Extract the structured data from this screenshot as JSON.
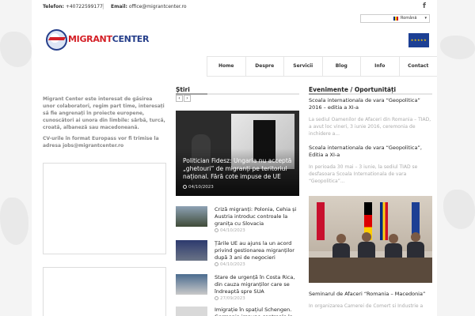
{
  "topbar": {
    "phone_label": "Telefon:",
    "phone": "+40722599177",
    "separator": "|",
    "email_label": "Email:",
    "email": "office@migrantcenter.ro",
    "social_icon": "f"
  },
  "language": {
    "selected": "Română",
    "caret": "▾"
  },
  "logo": {
    "word1": "MIGRANT",
    "word2": "CENTER"
  },
  "eu_flag_stars": "★★★★★",
  "nav": [
    "Home",
    "Despre",
    "Servicii",
    "Blog",
    "Info",
    "Contact"
  ],
  "intro": {
    "p1": "Migrant Center este interesat de găsirea unor colaboratori, regim part time, interesați să fie angrenați în proiecte europene, cunoscători ai unora din limbile: sârbă, turcă, croată, albaneză sau macedoneană.",
    "p2": "CV-urile în format Europass vor fi trimise la adresa jobs@migrantcenter.ro"
  },
  "news": {
    "title": "Știri",
    "prev": "‹",
    "next": "›",
    "featured": {
      "title": "Politician Fidesz: Ungaria nu acceptă „ghetouri” de migranți pe teritoriul național. Fără cote impuse de UE",
      "date": "04/10/2023"
    },
    "items": [
      {
        "title": "Criză migranți: Polonia, Cehia și Austria introduc controale la granița cu Slovacia",
        "date": "04/10/2023"
      },
      {
        "title": "Țările UE au ajuns la un acord privind gestionarea migranților după 3 ani de negocieri",
        "date": "04/10/2023"
      },
      {
        "title": "Stare de urgență în Costa Rica, din cauza migranților care se îndreaptă spre SUA",
        "date": "27/09/2023"
      },
      {
        "title": "Imigrație în spațiul Schengen. Germania impune controale la",
        "date": ""
      }
    ]
  },
  "events": {
    "title": "Evenimente / Oportunități",
    "items": [
      {
        "title": "Scoala internationala de vara “Geopolitica” 2016 – editia a XI-a",
        "excerpt": "La sediul Oamenilor de Afaceri din Romania – TIAD, a avut loc vineri, 3 iunie 2016, ceremonia de inchidere a..."
      },
      {
        "title": "Scoala internationala de vara “Geopolitica”, Editia a XI-a",
        "excerpt": "In perioada 30 mai – 3 iunie, la sediul TIAD se desfasoara Scoala Internationala de vara “Geopolitica”..."
      },
      {
        "title": "Seminarul de Afaceri “Romania – Macedonia”",
        "excerpt": "In organizarea Camerei de Comert si Industrie a"
      }
    ]
  }
}
